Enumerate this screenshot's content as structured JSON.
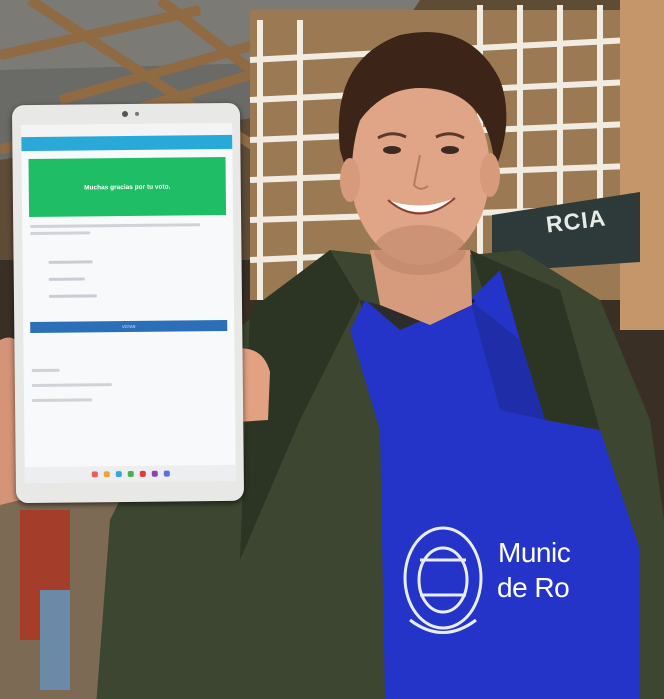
{
  "scene": {
    "sign_text": "RCIA",
    "apron_line_1": "Munic",
    "apron_line_2": "de Ro"
  },
  "tablet_screen": {
    "banner_text": "Muchas gracias por tu voto.",
    "button_label": "VOTAR"
  },
  "colors": {
    "banner_green": "#1fbe66",
    "header_blue": "#2aa8d8",
    "apron_blue": "#2434c8",
    "jacket_green": "#3c4630"
  }
}
